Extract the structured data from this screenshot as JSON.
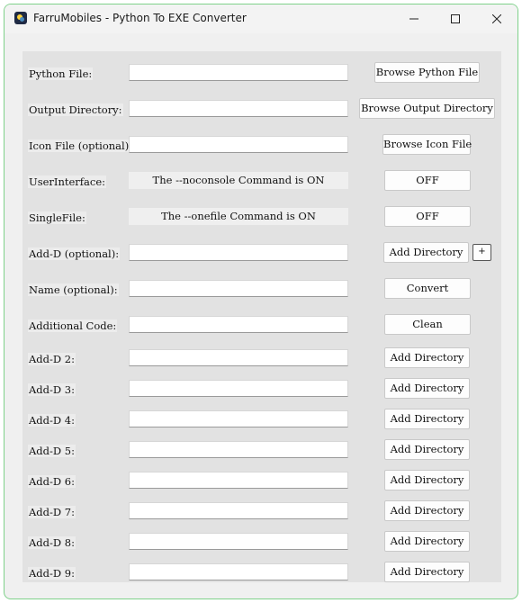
{
  "window": {
    "title": "FarruMobiles - Python To EXE Converter"
  },
  "rows": {
    "python_file": {
      "label": "Python File:",
      "button": "Browse Python File"
    },
    "output_dir": {
      "label": "Output Directory:",
      "button": "Browse Output Directory"
    },
    "icon_file": {
      "label": "Icon File (optional):",
      "button": "Browse Icon File"
    },
    "user_interface": {
      "label": "UserInterface:",
      "status": "The --noconsole Command is ON",
      "button": "OFF"
    },
    "single_file": {
      "label": "SingleFile:",
      "status": "The --onefile Command is ON",
      "button": "OFF"
    },
    "add_d": {
      "label": "Add-D (optional):",
      "button": "Add Directory",
      "plus": "+"
    },
    "name": {
      "label": "Name (optional):",
      "button": "Convert"
    },
    "additional_code": {
      "label": "Additional Code:",
      "button": "Clean"
    }
  },
  "add_dirs": [
    {
      "label": "Add-D 2:",
      "button": "Add Directory"
    },
    {
      "label": "Add-D 3:",
      "button": "Add Directory"
    },
    {
      "label": "Add-D 4:",
      "button": "Add Directory"
    },
    {
      "label": "Add-D 5:",
      "button": "Add Directory"
    },
    {
      "label": "Add-D 6:",
      "button": "Add Directory"
    },
    {
      "label": "Add-D 7:",
      "button": "Add Directory"
    },
    {
      "label": "Add-D 8:",
      "button": "Add Directory"
    },
    {
      "label": "Add-D 9:",
      "button": "Add Directory"
    }
  ]
}
